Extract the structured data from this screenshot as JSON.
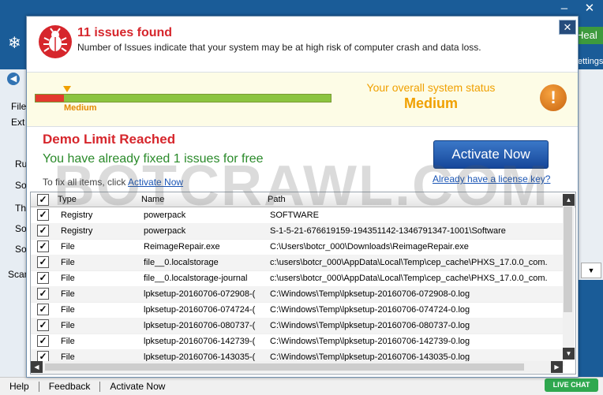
{
  "background": {
    "heal_label": "Heal",
    "settings_label": "ettings",
    "side_labels": [
      "File",
      "Ext",
      "Ru",
      "So",
      "Th",
      "So",
      "So",
      "Scan"
    ]
  },
  "bottom_bar": {
    "help": "Help",
    "feedback": "Feedback",
    "activate": "Activate Now",
    "live_chat": "LIVE CHAT"
  },
  "dialog": {
    "title": "11 issues found",
    "subtitle": "Number of Issues indicate that your system may be at high risk of computer crash and data loss.",
    "close_glyph": "✕",
    "status": {
      "meter_label": "Medium",
      "meter_level_fraction": 0.095,
      "overall_label": "Your overall system status",
      "overall_value": "Medium"
    },
    "demo_title": "Demo Limit Reached",
    "fixed_text": "You have already fixed 1 issues for free",
    "activate_button": "Activate Now",
    "license_link": "Already have a license key?",
    "fix_all_prefix": "To fix all items, click",
    "fix_all_link": "Activate Now",
    "table": {
      "columns": [
        "Type",
        "Name",
        "Path"
      ],
      "rows": [
        {
          "type": "Registry",
          "name": "powerpack",
          "path": "SOFTWARE"
        },
        {
          "type": "Registry",
          "name": "powerpack",
          "path": "S-1-5-21-676619159-194351142-1346791347-1001\\Software"
        },
        {
          "type": "File",
          "name": "ReimageRepair.exe",
          "path": "C:\\Users\\botcr_000\\Downloads\\ReimageRepair.exe"
        },
        {
          "type": "File",
          "name": "file__0.localstorage",
          "path": "c:\\users\\botcr_000\\AppData\\Local\\Temp\\cep_cache\\PHXS_17.0.0_com."
        },
        {
          "type": "File",
          "name": "file__0.localstorage-journal",
          "path": "c:\\users\\botcr_000\\AppData\\Local\\Temp\\cep_cache\\PHXS_17.0.0_com."
        },
        {
          "type": "File",
          "name": "lpksetup-20160706-072908-(",
          "path": "C:\\Windows\\Temp\\lpksetup-20160706-072908-0.log"
        },
        {
          "type": "File",
          "name": "lpksetup-20160706-074724-(",
          "path": "C:\\Windows\\Temp\\lpksetup-20160706-074724-0.log"
        },
        {
          "type": "File",
          "name": "lpksetup-20160706-080737-(",
          "path": "C:\\Windows\\Temp\\lpksetup-20160706-080737-0.log"
        },
        {
          "type": "File",
          "name": "lpksetup-20160706-142739-(",
          "path": "C:\\Windows\\Temp\\lpksetup-20160706-142739-0.log"
        },
        {
          "type": "File",
          "name": "lpksetup-20160706-143035-(",
          "path": "C:\\Windows\\Temp\\lpksetup-20160706-143035-0.log"
        }
      ]
    }
  },
  "watermark": "BOTCRAWL.COM",
  "colors": {
    "accent_red": "#d6262c",
    "accent_orange": "#f0a000",
    "accent_green": "#2a8a2a",
    "brand_blue": "#1a5c98"
  }
}
